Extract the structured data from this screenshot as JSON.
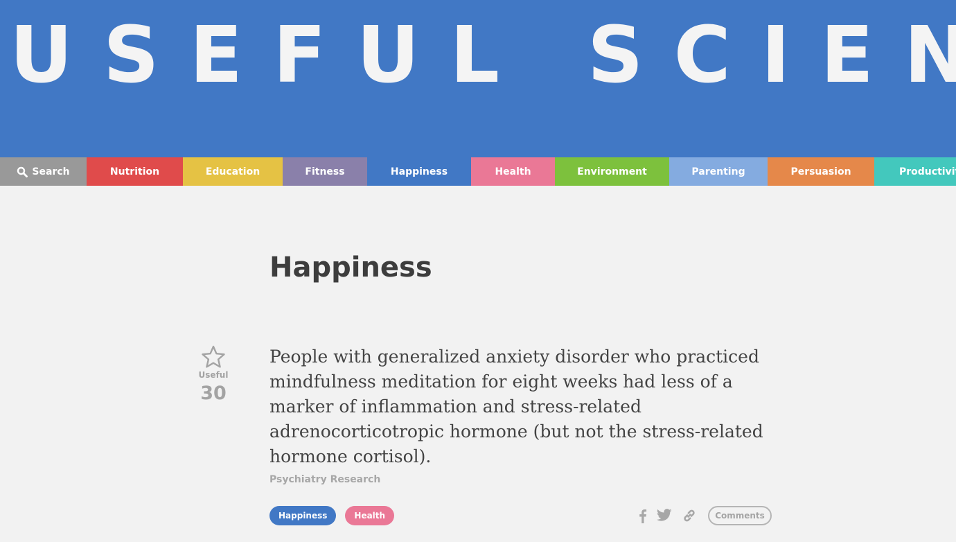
{
  "site": {
    "title": "USEFUL SCIENCE",
    "header_color": "#4178c5"
  },
  "nav": {
    "items": [
      {
        "label": "Search",
        "color": "#999999",
        "icon": "search-icon"
      },
      {
        "label": "Nutrition",
        "color": "#e04b4b"
      },
      {
        "label": "Education",
        "color": "#e5c244"
      },
      {
        "label": "Fitness",
        "color": "#8a80aa"
      },
      {
        "label": "Happiness",
        "color": "#4178c5",
        "active": true
      },
      {
        "label": "Health",
        "color": "#ea7896"
      },
      {
        "label": "Environment",
        "color": "#7dc13d"
      },
      {
        "label": "Parenting",
        "color": "#84abe0"
      },
      {
        "label": "Persuasion",
        "color": "#e5884a"
      },
      {
        "label": "Productivity",
        "color": "#43c8bd"
      }
    ]
  },
  "page": {
    "title": "Happiness"
  },
  "finding": {
    "useful_label": "Useful",
    "useful_count": "30",
    "text": "People with generalized anxiety disorder who practiced mindfulness meditation for eight weeks had less of a marker of inflammation and stress-related adrenocorticotropic hormone (but not the stress-related hormone cortisol).",
    "source": "Psychiatry Research",
    "tags": [
      {
        "label": "Happiness",
        "color": "#4178c5"
      },
      {
        "label": "Health",
        "color": "#ea7896"
      }
    ],
    "share_icons": [
      "facebook-icon",
      "twitter-icon",
      "link-icon"
    ],
    "comments_label": "Comments"
  }
}
